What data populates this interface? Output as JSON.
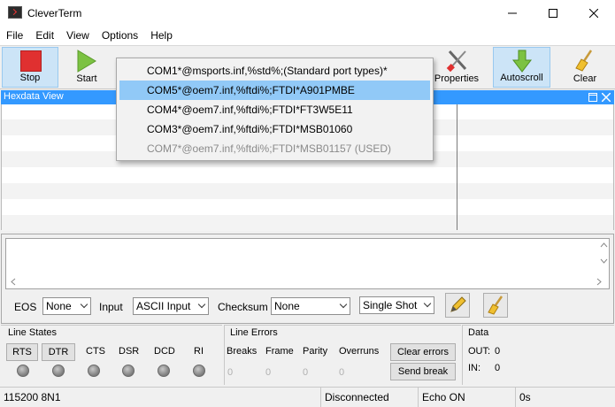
{
  "window": {
    "title": "CleverTerm"
  },
  "menu": [
    "File",
    "Edit",
    "View",
    "Options",
    "Help"
  ],
  "toolbar": {
    "stop_label": "Stop",
    "start_label": "Start",
    "properties_label": "Properties",
    "autoscroll_label": "Autoscroll",
    "clear_label": "Clear"
  },
  "hexview": {
    "title": "Hexdata View"
  },
  "port_menu": [
    {
      "label": "COM1*@msports.inf,%std%;(Standard port types)*"
    },
    {
      "label": "COM5*@oem7.inf,%ftdi%;FTDI*A901PMBE"
    },
    {
      "label": "COM4*@oem7.inf,%ftdi%;FTDI*FT3W5E11"
    },
    {
      "label": "COM3*@oem7.inf,%ftdi%;FTDI*MSB01060"
    },
    {
      "label": "COM7*@oem7.inf,%ftdi%;FTDI*MSB01157 (USED)"
    }
  ],
  "send": {
    "eos_label": "EOS",
    "eos_value": "None",
    "input_label": "Input",
    "input_value": "ASCII Input",
    "checksum_label": "Checksum",
    "checksum_value": "None",
    "mode_value": "Single Shot"
  },
  "line_states": {
    "title": "Line States",
    "rts": "RTS",
    "dtr": "DTR",
    "cts": "CTS",
    "dsr": "DSR",
    "dcd": "DCD",
    "ri": "RI"
  },
  "line_errors": {
    "title": "Line Errors",
    "breaks": "Breaks",
    "frame": "Frame",
    "parity": "Parity",
    "overruns": "Overruns",
    "breaks_val": "0",
    "frame_val": "0",
    "parity_val": "0",
    "overruns_val": "0",
    "clear_errors_label": "Clear errors",
    "send_break_label": "Send break"
  },
  "data_panel": {
    "title": "Data",
    "out_label": "OUT:",
    "out_value": "0",
    "in_label": "IN:",
    "in_value": "0"
  },
  "statusbar": {
    "port": "115200 8N1",
    "connection": "Disconnected",
    "echo": "Echo ON",
    "time": "0s"
  },
  "colors": {
    "accent": "#3399ff",
    "selection": "#91c9f7",
    "stop_red": "#e03030",
    "start_green": "#7cc242"
  }
}
